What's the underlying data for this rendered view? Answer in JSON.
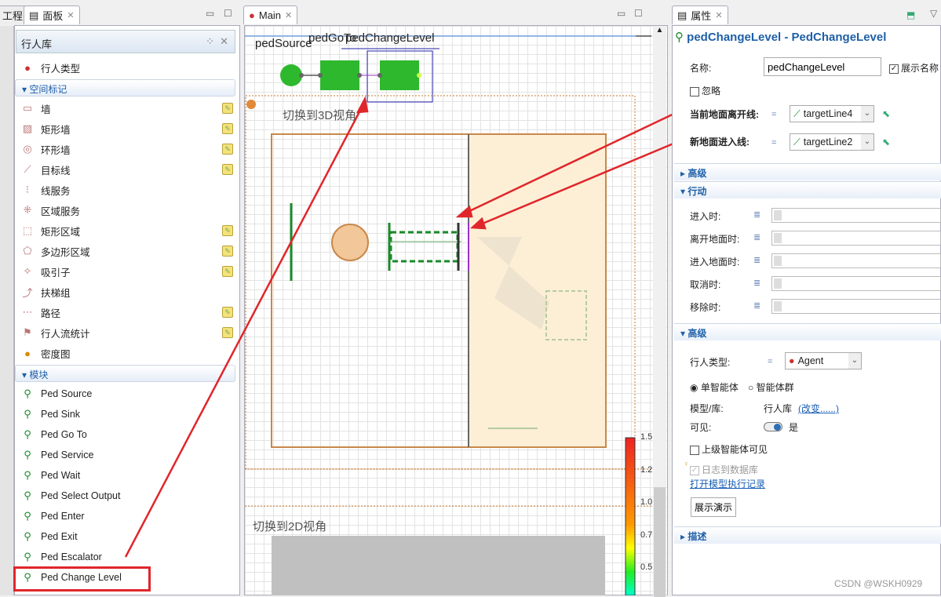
{
  "left": {
    "tab_project": "工程",
    "tab_palette": "面板",
    "library": "行人库",
    "ped_type": "行人类型",
    "section_space": "空间标记",
    "space_items": [
      {
        "label": "墙",
        "editable": true
      },
      {
        "label": "矩形墙",
        "editable": true
      },
      {
        "label": "环形墙",
        "editable": true
      },
      {
        "label": "目标线",
        "editable": true
      },
      {
        "label": "线服务",
        "editable": false
      },
      {
        "label": "区域服务",
        "editable": false
      },
      {
        "label": "矩形区域",
        "editable": true
      },
      {
        "label": "多边形区域",
        "editable": true
      },
      {
        "label": "吸引子",
        "editable": true
      },
      {
        "label": "扶梯组",
        "editable": false
      },
      {
        "label": "路径",
        "editable": true
      },
      {
        "label": "行人流统计",
        "editable": true
      },
      {
        "label": "密度图",
        "editable": false
      }
    ],
    "section_blocks": "模块",
    "block_items": [
      "Ped Source",
      "Ped Sink",
      "Ped Go To",
      "Ped Service",
      "Ped Wait",
      "Ped Select Output",
      "Ped Enter",
      "Ped Exit",
      "Ped Escalator",
      "Ped Change Level"
    ]
  },
  "main": {
    "tab": "Main",
    "label_source": "pedSource",
    "label_goto": "pedGoTo",
    "label_change": "pedChangeLevel",
    "view3d": "切换到3D视角",
    "view2d": "切换到2D视角",
    "legend_ticks": [
      "1.5",
      "1.2",
      "1.0",
      "0.7",
      "0.5"
    ]
  },
  "props": {
    "tab": "属性",
    "title": "pedChangeLevel - PedChangeLevel",
    "name_label": "名称:",
    "name_value": "pedChangeLevel",
    "show_name": "展示名称",
    "ignore": "忽略",
    "leave_label": "当前地面离开线:",
    "leave_value": "targetLine4",
    "enter_label": "新地面进入线:",
    "enter_value": "targetLine2",
    "sec_advanced1": "高级",
    "sec_action": "行动",
    "actions": [
      "进入时:",
      "离开地面时:",
      "进入地面时:",
      "取消时:",
      "移除时:"
    ],
    "sec_advanced2": "高级",
    "ped_type_label": "行人类型:",
    "ped_type_value": "Agent",
    "radio_single": "单智能体",
    "radio_group": "智能体群",
    "model_label": "模型/库:",
    "model_value": "行人库",
    "change_link": "(改变......)",
    "visible_label": "可见:",
    "visible_value": "是",
    "upper_visible": "上级智能体可见",
    "log_db": "日志到数据库",
    "open_log": "打开模型执行记录",
    "demo_button": "展示演示",
    "sec_desc": "描述"
  },
  "watermark": "CSDN @WSKH0929",
  "colors": {
    "accent": "#1e5fa8",
    "annotation": "#e0262b",
    "block_green": "#2eb82e"
  }
}
